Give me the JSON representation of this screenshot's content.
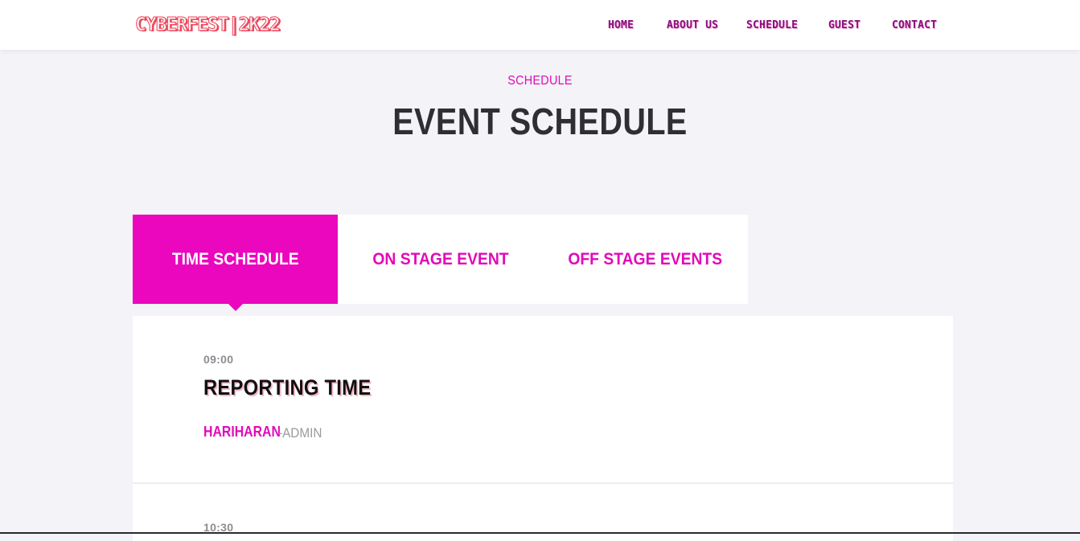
{
  "header": {
    "logo": "CYBERFEST|2K22",
    "nav": [
      "HOME",
      "ABOUT US",
      "SCHEDULE",
      "GUEST",
      "CONTACT"
    ]
  },
  "section": {
    "eyebrow": "SCHEDULE",
    "title": "EVENT SCHEDULE"
  },
  "tabs": {
    "items": [
      "TIME SCHEDULE",
      "ON STAGE EVENT",
      "OFF STAGE EVENTS"
    ],
    "active": "TIME SCHEDULE"
  },
  "schedule": [
    {
      "time": "09:00",
      "title": "REPORTING TIME",
      "speaker": "HARIHARAN",
      "role": "-ADMIN"
    },
    {
      "time": "10:30"
    }
  ],
  "colors": {
    "accent": "#ea07be",
    "accent_text": "#e10ab9",
    "nav_text": "#8a0f7a",
    "logo": "#f0465c",
    "page_bg": "#f3f3f8",
    "title": "#2f2f33"
  }
}
